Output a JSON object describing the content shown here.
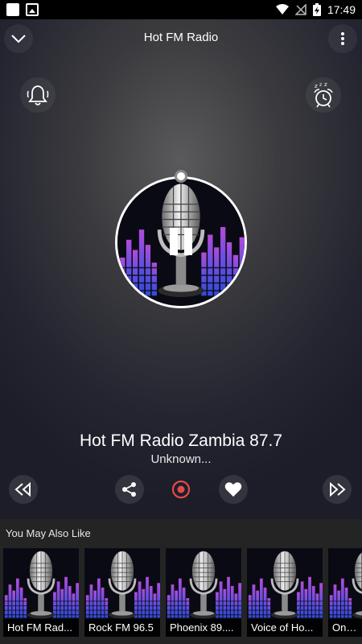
{
  "status_bar": {
    "time": "17:49"
  },
  "header": {
    "title": "Hot FM Radio"
  },
  "player": {
    "station_name": "Hot FM Radio Zambia 87.7",
    "now_playing": "Unknown...",
    "state": "playing",
    "record_color": "#e34a4a"
  },
  "suggestions": {
    "title": "You May Also Like",
    "items": [
      {
        "label": "Hot FM Rad..."
      },
      {
        "label": "Rock FM 96.5"
      },
      {
        "label": "Phoenix 89...."
      },
      {
        "label": "Voice of Ho..."
      },
      {
        "label": "One L"
      }
    ]
  },
  "icons": {
    "back": "chevron-down-icon",
    "menu": "more-vert-icon",
    "bell": "bell-icon",
    "sleep": "alarm-clock-zzz-icon",
    "prev": "rewind-icon",
    "share": "share-icon",
    "record": "record-icon",
    "favorite": "heart-icon",
    "next": "fast-forward-icon",
    "pause": "pause-icon"
  }
}
